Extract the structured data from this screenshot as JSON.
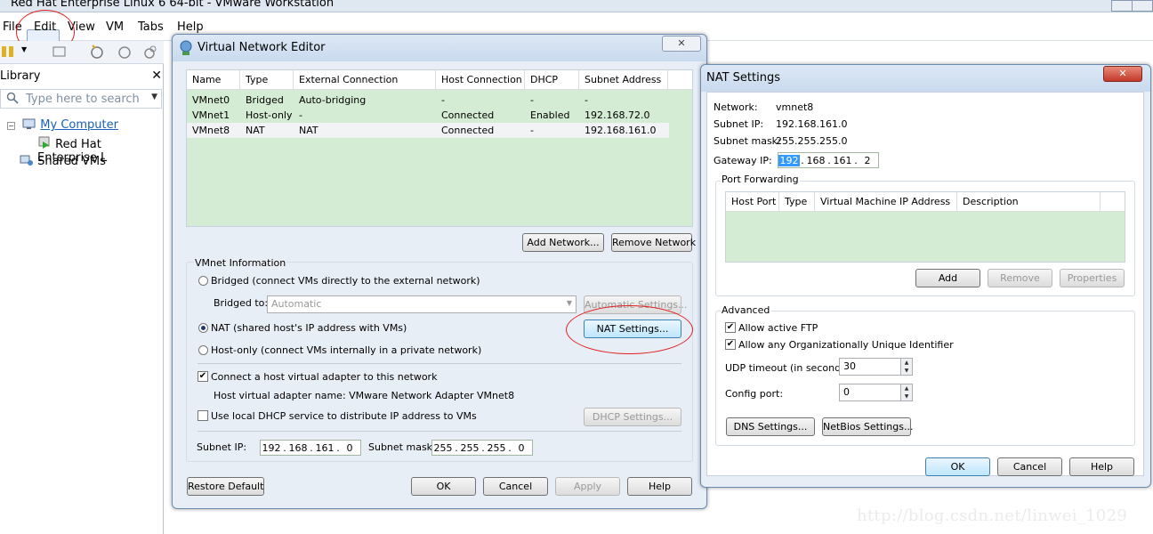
{
  "window": {
    "title": "Red Hat Enterprise Linux 6 64-bit - VMware Workstation"
  },
  "menu": {
    "file": "File",
    "edit": "Edit",
    "view": "View",
    "vm": "VM",
    "tabs": "Tabs",
    "help": "Help"
  },
  "library": {
    "title": "Library",
    "close": "✕",
    "search_placeholder": "Type here to search",
    "items": [
      "My Computer",
      "Red Hat Enterprise L",
      "Shared VMs"
    ]
  },
  "vne": {
    "title": "Virtual Network Editor",
    "columns": [
      "Name",
      "Type",
      "External Connection",
      "Host Connection",
      "DHCP",
      "Subnet Address"
    ],
    "rows": [
      [
        "VMnet0",
        "Bridged",
        "Auto-bridging",
        "-",
        "-",
        "-"
      ],
      [
        "VMnet1",
        "Host-only",
        "-",
        "Connected",
        "Enabled",
        "192.168.72.0"
      ],
      [
        "VMnet8",
        "NAT",
        "NAT",
        "Connected",
        "-",
        "192.168.161.0"
      ]
    ],
    "add_network": "Add Network...",
    "remove_network": "Remove Network",
    "vmnet_info": "VMnet Information",
    "bridged_label": "Bridged (connect VMs directly to the external network)",
    "bridged_to_label": "Bridged to:",
    "bridged_to_value": "Automatic",
    "automatic_settings": "Automatic Settings...",
    "nat_label": "NAT (shared host's IP address with VMs)",
    "nat_settings": "NAT Settings...",
    "hostonly_label": "Host-only (connect VMs internally in a private network)",
    "connect_adapter": "Connect a host virtual adapter to this network",
    "adapter_name": "Host virtual adapter name: VMware Network Adapter VMnet8",
    "use_dhcp": "Use local DHCP service to distribute IP address to VMs",
    "dhcp_settings": "DHCP Settings...",
    "subnet_ip_label": "Subnet IP:",
    "subnet_ip": [
      "192",
      "168",
      "161",
      "0"
    ],
    "subnet_mask_label": "Subnet mask:",
    "subnet_mask": [
      "255",
      "255",
      "255",
      "0"
    ],
    "restore_default": "Restore Default",
    "ok": "OK",
    "cancel": "Cancel",
    "apply": "Apply",
    "help": "Help"
  },
  "nat": {
    "title": "NAT Settings",
    "network_label": "Network:",
    "network_value": "vmnet8",
    "subnet_ip_label": "Subnet IP:",
    "subnet_ip_value": "192.168.161.0",
    "subnet_mask_label": "Subnet mask:",
    "subnet_mask_value": "255.255.255.0",
    "gateway_label": "Gateway IP:",
    "gateway_ip": [
      "192",
      "168",
      "161",
      "2"
    ],
    "port_forwarding": "Port Forwarding",
    "pf_columns": [
      "Host Port",
      "Type",
      "Virtual Machine IP Address",
      "Description"
    ],
    "add": "Add",
    "remove": "Remove",
    "properties": "Properties",
    "advanced": "Advanced",
    "allow_ftp": "Allow active FTP",
    "allow_oui": "Allow any Organizationally Unique Identifier",
    "udp_label": "UDP timeout (in seconds):",
    "udp_value": "30",
    "config_port_label": "Config port:",
    "config_port_value": "0",
    "dns_settings": "DNS Settings...",
    "netbios_settings": "NetBios Settings...",
    "ok": "OK",
    "cancel": "Cancel",
    "help": "Help"
  },
  "watermark": "http://blog.csdn.net/linwei_1029",
  "colors": {
    "accent": "#1b5fb8",
    "table_bg": "#d5ecd4",
    "annotation": "#e02020"
  }
}
